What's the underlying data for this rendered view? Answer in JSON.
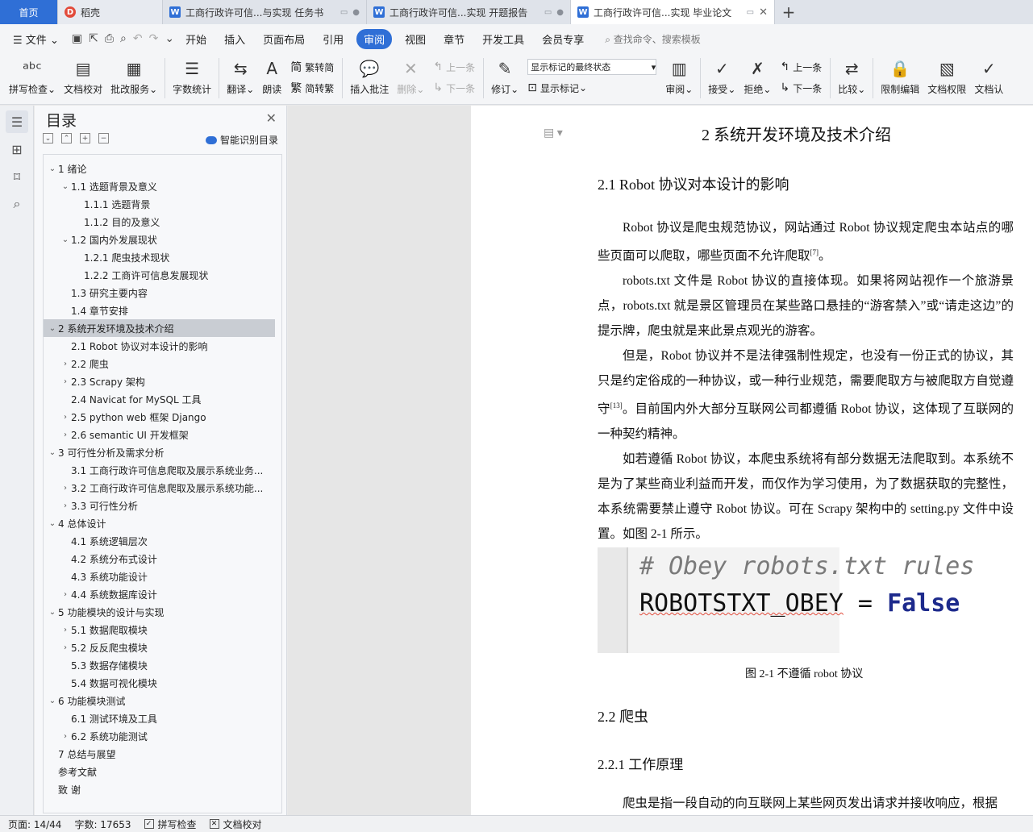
{
  "tabs": [
    {
      "label": "首页"
    },
    {
      "label": "稻壳"
    },
    {
      "label": "工商行政许可信...与实现 任务书"
    },
    {
      "label": "工商行政许可信...实现 开题报告"
    },
    {
      "label": "工商行政许可信...实现 毕业论文"
    }
  ],
  "menu": {
    "file": "文件",
    "items": [
      "开始",
      "插入",
      "页面布局",
      "引用",
      "审阅",
      "视图",
      "章节",
      "开发工具",
      "会员专享"
    ],
    "search": "查找命令、搜索模板"
  },
  "ribbon": {
    "spell_check": "拼写检查",
    "doc_proof": "文档校对",
    "batch_service": "批改服务",
    "word_count": "字数统计",
    "translate": "翻译",
    "read_aloud": "朗读",
    "trad_to_simp": "繁转简",
    "simp_to_trad": "简转繁",
    "insert_comment": "插入批注",
    "delete": "删除",
    "prev": "上一条",
    "next": "下一条",
    "revise": "修订",
    "markup_select": "显示标记的最终状态",
    "show_markup": "显示标记",
    "review": "审阅",
    "accept": "接受",
    "reject": "拒绝",
    "prev2": "上一条",
    "next2": "下一条",
    "compare": "比较",
    "restrict_edit": "限制编辑",
    "doc_rights": "文档权限",
    "doc_cert": "文档认"
  },
  "toc": {
    "title": "目录",
    "smart": "智能识别目录",
    "items": [
      "1 绪论",
      "1.1 选题背景及意义",
      "1.1.1 选题背景",
      "1.1.2 目的及意义",
      "1.2 国内外发展现状",
      "1.2.1 爬虫技术现状",
      "1.2.2 工商许可信息发展现状",
      "1.3 研究主要内容",
      "1.4 章节安排",
      "2 系统开发环境及技术介绍",
      "2.1 Robot 协议对本设计的影响",
      "2.2 爬虫",
      "2.3 Scrapy 架构",
      "2.4 Navicat for MySQL 工具",
      "2.5 python web 框架 Django",
      "2.6 semantic UI 开发框架",
      "3 可行性分析及需求分析",
      "3.1 工商行政许可信息爬取及展示系统业务...",
      "3.2 工商行政许可信息爬取及展示系统功能...",
      "3.3 可行性分析",
      "4 总体设计",
      "4.1 系统逻辑层次",
      "4.2 系统分布式设计",
      "4.3 系统功能设计",
      "4.4 系统数据库设计",
      "5 功能模块的设计与实现",
      "5.1 数据爬取模块",
      "5.2 反反爬虫模块",
      "5.3 数据存储模块",
      "5.4 数据可视化模块",
      "6 功能模块测试",
      "6.1 测试环境及工具",
      "6.2 系统功能测试",
      "7 总结与展望",
      "参考文献",
      "致 谢"
    ]
  },
  "document": {
    "chapter": "2 系统开发环境及技术介绍",
    "section_2_1": "2.1 Robot 协议对本设计的影响",
    "p1": "Robot 协议是爬虫规范协议，网站通过 Robot 协议规定爬虫本站点的哪些页面可以爬取，哪些页面不允许爬取",
    "p1_ref": "[7]",
    "p1_end": "。",
    "p2": "robots.txt 文件是 Robot 协议的直接体现。如果将网站视作一个旅游景点，robots.txt 就是景区管理员在某些路口悬挂的“游客禁入”或“请走这边”的提示牌，爬虫就是来此景点观光的游客。",
    "p3a": "但是，Robot 协议并不是法律强制性规定，也没有一份正式的协议，其只是约定俗成的一种协议，或一种行业规范，需要爬取方与被爬取方自觉遵守",
    "p3_ref": "[13]",
    "p3b": "。目前国内外大部分互联网公司都遵循 Robot 协议，这体现了互联网的一种契约精神。",
    "p4": "如若遵循 Robot 协议，本爬虫系统将有部分数据无法爬取到。本系统不是为了某些商业利益而开发，而仅作为学习使用，为了数据获取的完整性，本系统需要禁止遵守 Robot 协议。可在 Scrapy 架构中的 setting.py 文件中设置。如图 2-1 所示。",
    "code_comment": "# Obey robots.txt rules",
    "code_var": "ROBOTSTXT_OBEY",
    "code_eq": " = ",
    "code_val": "False",
    "caption": "图 2-1 不遵循 robot 协议",
    "section_2_2": "2.2 爬虫",
    "section_2_2_1": "2.2.1 工作原理",
    "p5": "爬虫是指一段自动的向互联网上某些网页发出请求并接收响应，根据"
  },
  "status": {
    "page": "页面: 14/44",
    "words": "字数: 17653",
    "spell": "拼写检查",
    "proof": "文档校对"
  },
  "colors": {
    "accent": "#2f6fd6",
    "selected_toc": "#c9cdd3"
  }
}
